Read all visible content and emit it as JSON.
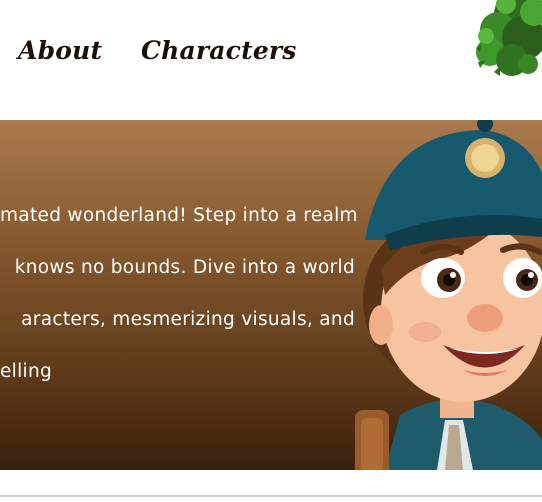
{
  "nav": {
    "items": [
      {
        "label": "About"
      },
      {
        "label": "Characters"
      }
    ]
  },
  "hero": {
    "lines": [
      "mated wonderland! Step into a realm",
      "knows no bounds. Dive into a world",
      "aracters,   mesmerizing   visuals,   and",
      "elling"
    ]
  },
  "colors": {
    "nav_text": "#1b1108",
    "hero_gradient_top": "#a97a4e",
    "hero_gradient_bottom": "#3a210c",
    "hero_text": "#ffffff"
  },
  "icons": {
    "tree": "tree-foliage-icon",
    "character": "cartoon-boy-illustration"
  }
}
